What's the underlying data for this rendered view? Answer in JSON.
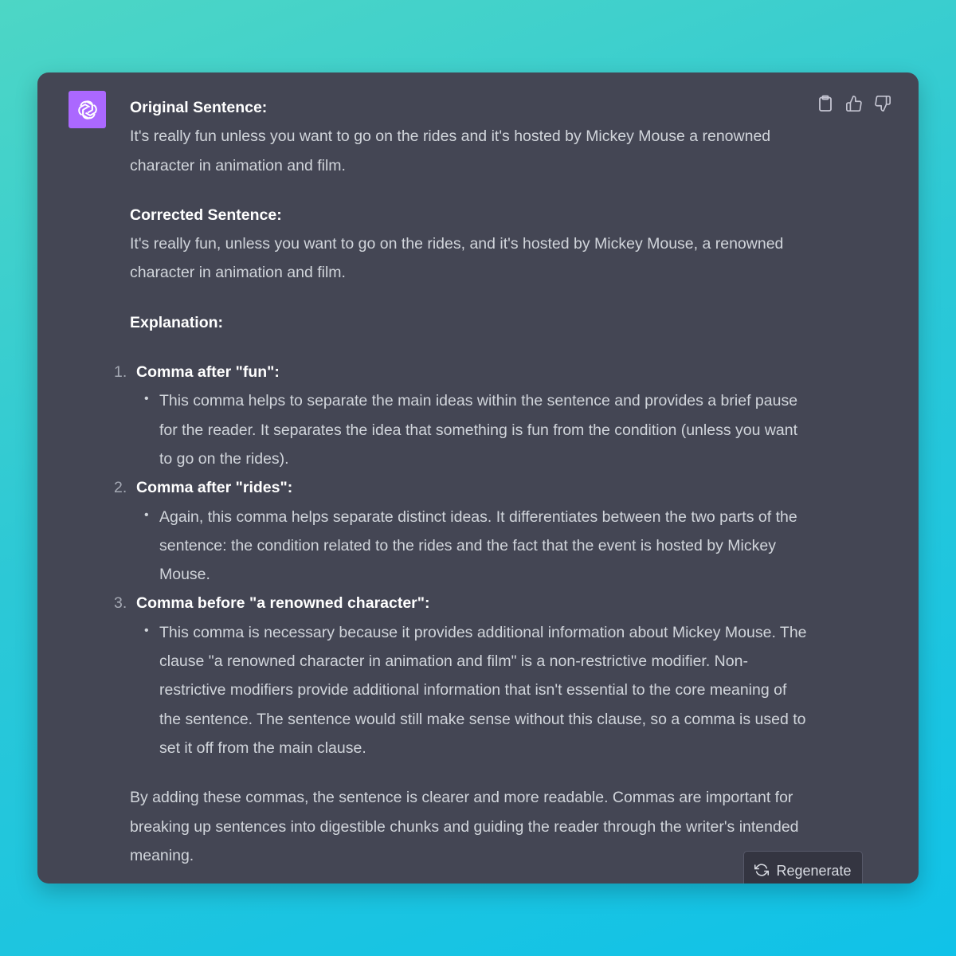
{
  "message": {
    "original_heading": "Original Sentence:",
    "original_text": "It's really fun unless you want to go on the rides and it's hosted by Mickey Mouse a renowned character in animation and film.",
    "corrected_heading": "Corrected Sentence:",
    "corrected_text": "It's really fun, unless you want to go on the rides, and it's hosted by Mickey Mouse, a renowned character in animation and film.",
    "explanation_heading": "Explanation:",
    "items": [
      {
        "number": "1.",
        "title": "Comma after \"fun\":",
        "detail": "This comma helps to separate the main ideas within the sentence and provides a brief pause for the reader. It separates the idea that something is fun from the condition (unless you want to go on the rides)."
      },
      {
        "number": "2.",
        "title": "Comma after \"rides\":",
        "detail": "Again, this comma helps separate distinct ideas. It differentiates between the two parts of the sentence: the condition related to the rides and the fact that the event is hosted by Mickey Mouse."
      },
      {
        "number": "3.",
        "title": "Comma before \"a renowned character\":",
        "detail": "This comma is necessary because it provides additional information about Mickey Mouse. The clause \"a renowned character in animation and film\" is a non-restrictive modifier. Non-restrictive modifiers provide additional information that isn't essential to the core meaning of the sentence. The sentence would still make sense without this clause, so a comma is used to set it off from the main clause."
      }
    ],
    "conclusion": "By adding these commas, the sentence is clearer and more readable. Commas are important for breaking up sentences into digestible chunks and guiding the reader through the writer's intended meaning."
  },
  "regenerate_label": "Regenerate",
  "icons": {
    "avatar": "openai-logo-icon",
    "copy": "clipboard-icon",
    "like": "thumbs-up-icon",
    "dislike": "thumbs-down-icon",
    "regenerate": "refresh-icon"
  },
  "colors": {
    "card_background": "#444654",
    "avatar_background": "#ab68ff",
    "text": "#d1d5db",
    "heading": "#ffffff",
    "button_background": "#343541"
  }
}
